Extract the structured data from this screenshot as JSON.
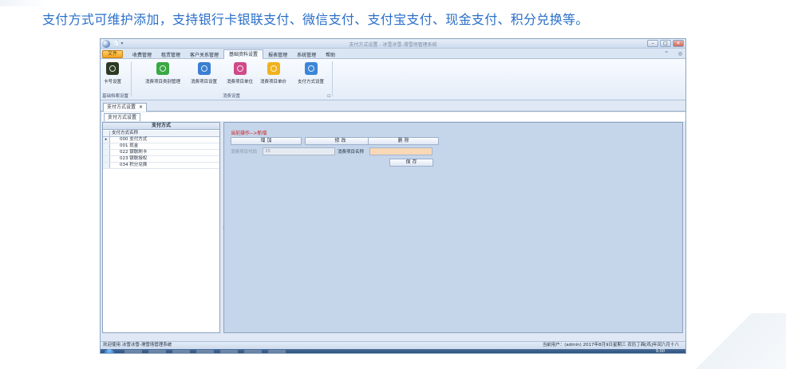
{
  "headline": "支付方式可维护添加，支持银行卡银联支付、微信支付、支付宝支付、现金支付、积分兑换等。",
  "window": {
    "title": "支付方式设置 - 冰雪冰雪-滑雪场管理系统",
    "qat": "📄 ▾",
    "buttons": {
      "min": "–",
      "max": "□",
      "close": "✕"
    }
  },
  "menu": {
    "file": "文件",
    "items": [
      "收费管理",
      "租赁管理",
      "客户关系管理",
      "基础资料设置",
      "报表管理",
      "系统管理",
      "帮助"
    ],
    "active_index": 3,
    "right": [
      "^",
      "◎"
    ]
  },
  "ribbon": {
    "buttons": [
      {
        "label": "卡号设置",
        "icon": "card-reader-icon",
        "color": "#2b3a22"
      },
      {
        "label": "消费项目类别管理",
        "icon": "category-icon",
        "color": "#3aa843"
      },
      {
        "label": "消费项目设置",
        "icon": "item-settings-icon",
        "color": "#3b7fd0"
      },
      {
        "label": "消费项目单位",
        "icon": "unit-icon",
        "color": "#d04a8a"
      },
      {
        "label": "消费项目单价",
        "icon": "price-icon",
        "color": "#f0b21e"
      },
      {
        "label": "支付方式设置",
        "icon": "payment-search-icon",
        "color": "#3b86d8"
      }
    ],
    "groups": [
      "基础档案设置",
      "消费设置"
    ],
    "launcher": "⊡"
  },
  "doc_tab": {
    "label": "支付方式设置",
    "close": "✕"
  },
  "inner_tab": {
    "label": "支付方式设置"
  },
  "left_panel": {
    "title": "支付方式",
    "column": "支付方式名称",
    "rows": [
      "000 支付方式",
      "001 现金",
      "022 银联刷卡",
      "023 银联授权",
      "034 积分兑换"
    ],
    "selected_index": 0,
    "indicator": "▸"
  },
  "right_panel": {
    "operation": "当前操作-->新增",
    "buttons": {
      "add": "增 加",
      "edit": "修 改",
      "delete": "删 除",
      "save": "保 存"
    },
    "fields": {
      "code_label": "消费项目代码",
      "code_value": "35",
      "name_label": "消费项目名称",
      "name_value": ""
    },
    "colors": {
      "name_input_bg": "#f9d8b8"
    }
  },
  "status": {
    "left": "欢迎使用 冰雪冰雪-滑雪场管理系统",
    "right": "当前用户：(admin)  2017年8月9日星期三 农历丁酉[鸡]年闰六月十八"
  },
  "taskbar": {
    "clock": "9:00"
  }
}
